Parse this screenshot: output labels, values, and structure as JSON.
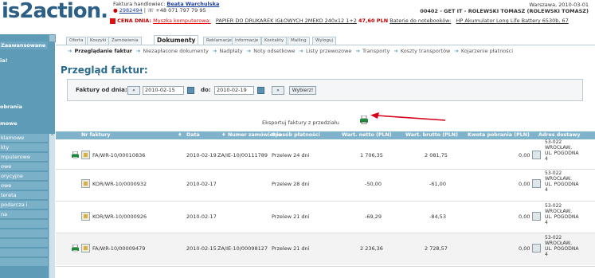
{
  "header": {
    "logo": "is2action.pl",
    "seller_label": "Faktura handlowiec:",
    "seller_name": "Beata Warchulska",
    "seller_ids": "2982494",
    "seller_phone": "+48 071 797 79 95",
    "date_line": "Warszawa, 2010-03-01",
    "client_line": "00402 - GET IT - ROLEWSKI TOMASZ (ROLEWSKI TOMASZ)",
    "promo_label": "CENA DNIA:",
    "promo_subject": "Myszka komputerowa:",
    "promo_item": "PAPIER DO DRUKAREK IGŁOWYCH 2MEKO 240x12 1+2",
    "promo_price": "47,60 PLN",
    "promo_link2": "Baterie do notebooków:",
    "promo_link3": "HP Akumulator Long Life Battery 6530b, 67"
  },
  "sidebar": {
    "top_label": "Zaawansowane «",
    "items": [
      "ia!",
      "obrania",
      "mowe",
      "klamowe",
      "kty",
      "mputerowe",
      "owe",
      "orycyjne",
      "owe",
      "tereta",
      "podarcza i",
      "na"
    ]
  },
  "tabs": [
    "Oferta",
    "Koszyki",
    "Zamówienia",
    "Dokumenty",
    "Reklamacje",
    "Informacje",
    "Kontakty",
    "Mailing",
    "Wyloguj"
  ],
  "active_tab": "Dokumenty",
  "breadcrumbs": [
    "Przeglądanie faktur",
    "Niezapłacone dokumenty",
    "Nadpłaty",
    "Noty odsetkowe",
    "Listy przewozowe",
    "Transporty",
    "Koszty transportów",
    "Kojarzenie płatności"
  ],
  "page_title": "Przegląd faktur:",
  "filter": {
    "from_label": "Faktury od dnia:",
    "from_value": "2010-02-15",
    "to_label": "do:",
    "to_value": "2010-02-19",
    "prev_btn": "«",
    "next_btn": "»",
    "submit": "Wybierz!"
  },
  "export_label": "Eksportuj faktury z przedziału",
  "table": {
    "columns": [
      "Nr faktury",
      "Data",
      "Numer zamówienia",
      "Sposób płatności",
      "Wart. netto (PLN)",
      "Wart. brutto (PLN)",
      "Kwota pobrania (PLN)",
      "Adres dostawy"
    ],
    "rows": [
      {
        "nr": "FA/WR-10/00010836",
        "data": "2010-02-19",
        "zam": "ZA/IE-10/00111789",
        "sposob": "Przelew 24 dni",
        "netto": "1 706,35",
        "brutto": "2 081,75",
        "pobranie": "0,00",
        "addr": [
          "53-022",
          "WROCŁAW,",
          "UL. POGODNA",
          "4"
        ]
      },
      {
        "nr": "KOR/WR-10/0000932",
        "data": "2010-02-17",
        "zam": "",
        "sposob": "Przelew 28 dni",
        "netto": "-50,00",
        "brutto": "-61,00",
        "pobranie": "0,00",
        "addr": [
          "53-022",
          "WROCŁAW,",
          "UL. POGODNA",
          "4"
        ]
      },
      {
        "nr": "KOR/WR-10/0000926",
        "data": "2010-02-17",
        "zam": "",
        "sposob": "Przelew 21 dni",
        "netto": "-69,29",
        "brutto": "-84,53",
        "pobranie": "0,00",
        "addr": [
          "53-022",
          "WROCŁAW,",
          "UL. POGODNA",
          "4"
        ]
      },
      {
        "nr": "FA/WR-10/00009479",
        "data": "2010-02-15",
        "zam": "ZA/IE-10/00098127",
        "sposob": "Przelew 21 dni",
        "netto": "2 236,36",
        "brutto": "2 728,57",
        "pobranie": "0,00",
        "addr": [
          "53-022",
          "WROCŁAW,",
          "UL. POGODNA",
          "4"
        ]
      }
    ]
  },
  "colors": {
    "accent": "#5e9bb7",
    "header_row": "#7fb2cb",
    "title": "#2a6b8e",
    "arrow": "#d6001c"
  }
}
